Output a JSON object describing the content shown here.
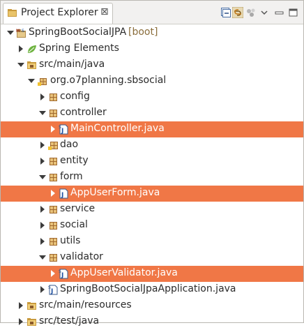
{
  "view": {
    "title": "Project Explorer",
    "close_glyph": "⊠",
    "toolbar": [
      {
        "name": "collapse-all-button",
        "icon": "collapse-all-icon"
      },
      {
        "name": "link-with-editor-button",
        "icon": "link-with-editor-icon"
      },
      {
        "name": "focus-on-active-task-button",
        "icon": "focus-task-icon"
      },
      {
        "name": "view-menu-button",
        "icon": "chevron-down-icon"
      },
      {
        "name": "minimize-button",
        "icon": "minimize-icon"
      },
      {
        "name": "maximize-button",
        "icon": "maximize-icon"
      }
    ]
  },
  "tree": {
    "project": {
      "label": "SpringBootSocialJPA",
      "suffix": "[boot]"
    },
    "spring_elements": "Spring Elements",
    "src_main_java": "src/main/java",
    "package_root": "org.o7planning.sbsocial",
    "config": "config",
    "controller": "controller",
    "main_controller": "MainController.java",
    "dao": "dao",
    "entity": "entity",
    "form": "form",
    "app_user_form": "AppUserForm.java",
    "service": "service",
    "social": "social",
    "utils": "utils",
    "validator": "validator",
    "app_user_validator": "AppUserValidator.java",
    "application": "SpringBootSocialJpaApplication.java",
    "src_main_resources": "src/main/resources",
    "src_test_java": "src/test/java"
  },
  "colors": {
    "selection": "#f07746",
    "package_icon": "#8b5a2b",
    "folder_icon": "#d9a441",
    "spring_leaf": "#6db33f"
  }
}
